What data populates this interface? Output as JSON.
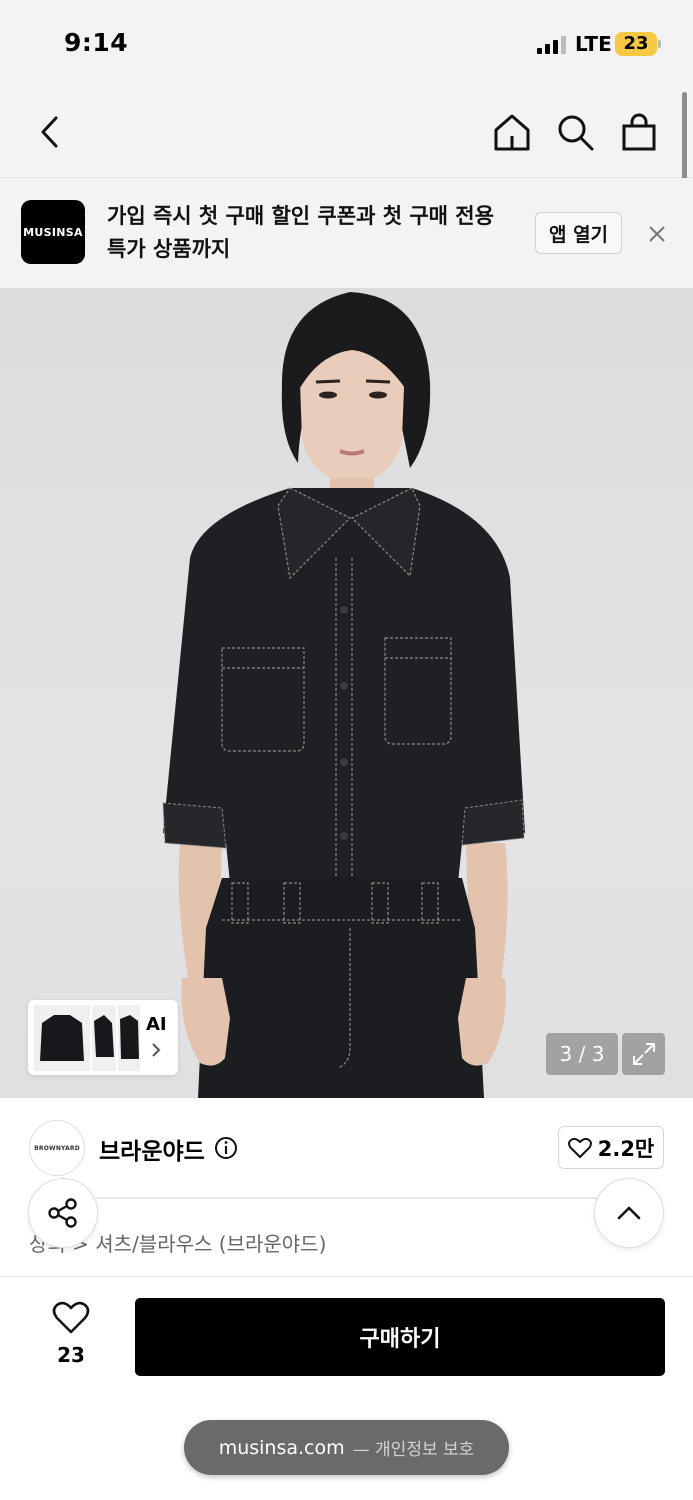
{
  "status_bar": {
    "time": "9:14",
    "network": "LTE",
    "battery": "23",
    "battery_color": "#f6c844"
  },
  "nav": {
    "back_icon": "chevron-left-icon",
    "home_icon": "home-icon",
    "search_icon": "search-icon",
    "cart_icon": "shopping-bag-icon"
  },
  "banner": {
    "logo_text": "MUSINSA",
    "message": "가입 즉시 첫 구매 할인 쿠폰과 첫 구매 전용 특가 상품까지",
    "open_app_label": "앱 열기",
    "close_icon": "close-icon"
  },
  "gallery": {
    "counter": "3 / 3",
    "ai_label": "AI",
    "expand_icon": "expand-icon"
  },
  "product": {
    "brand_logo_text": "BROWNYARD",
    "brand_name": "브라운야드",
    "likes": "2.2만",
    "breadcrumb": "상의 > 셔츠/블라우스 (브라운야드)"
  },
  "buy_bar": {
    "like_count": "23",
    "buy_label": "구매하기"
  },
  "browser": {
    "domain": "musinsa.com",
    "privacy": "— 개인정보 보호"
  }
}
